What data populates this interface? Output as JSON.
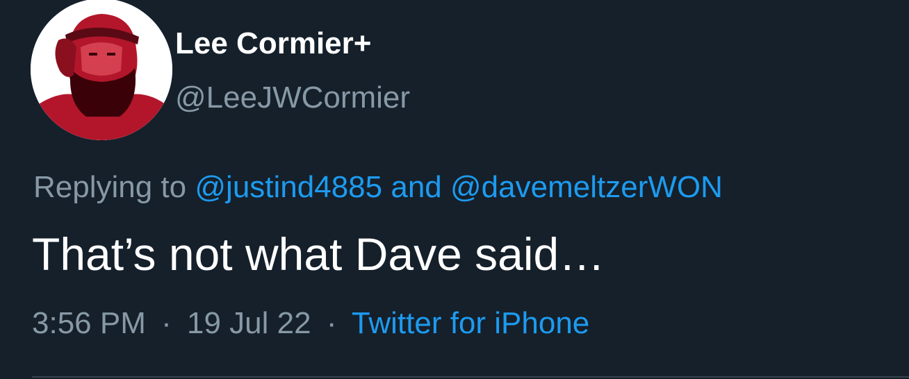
{
  "colors": {
    "background": "#15202b",
    "primary_text": "#ffffff",
    "secondary_text": "#8899a6",
    "accent": "#1d9bf0",
    "avatar_tint": "#b3162b"
  },
  "tweet": {
    "author": {
      "display_name": "Lee Cormier+",
      "handle": "@LeeJWCormier",
      "avatar_icon": "profile-avatar"
    },
    "reply_context": {
      "prefix": "Replying to",
      "mentions": [
        "@justind4885",
        "@davemeltzerWON"
      ],
      "joiner": "and"
    },
    "text": "That’s not what Dave said…",
    "meta": {
      "time": "3:56 PM",
      "separator": "·",
      "date": "19 Jul 22",
      "source": "Twitter for iPhone"
    }
  }
}
